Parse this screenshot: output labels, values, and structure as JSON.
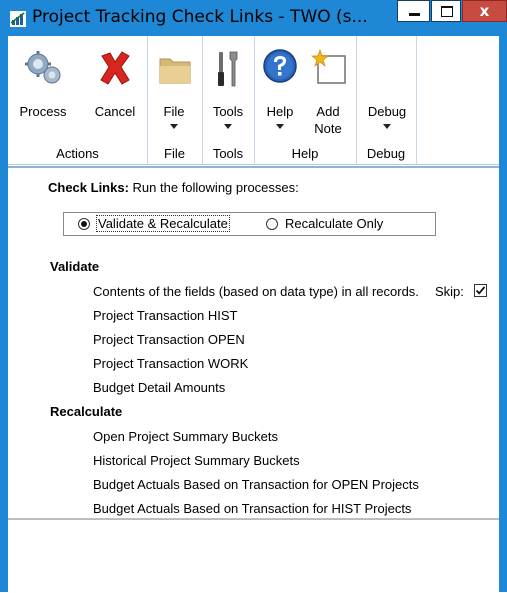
{
  "window": {
    "title": "Project Tracking Check Links  -  TWO (s...",
    "close_glyph": "x"
  },
  "ribbon": {
    "groups": [
      {
        "label": "Actions",
        "buttons": [
          {
            "label": "Process",
            "icon": "gears-icon"
          },
          {
            "label": "Cancel",
            "icon": "red-x-icon"
          }
        ]
      },
      {
        "label": "File",
        "buttons": [
          {
            "label": "File",
            "icon": "folder-icon"
          }
        ]
      },
      {
        "label": "Tools",
        "buttons": [
          {
            "label": "Tools",
            "icon": "tools-icon"
          }
        ]
      },
      {
        "label": "Help",
        "buttons": [
          {
            "label": "Help",
            "icon": "help-icon"
          },
          {
            "label_line1": "Add",
            "label_line2": "Note",
            "icon": "note-icon"
          }
        ]
      },
      {
        "label": "Debug",
        "buttons": [
          {
            "label": "Debug"
          }
        ]
      }
    ]
  },
  "form": {
    "check_links_label": "Check Links:",
    "check_links_desc": "Run the following processes:",
    "options": [
      {
        "label": "Validate & Recalculate",
        "selected": true
      },
      {
        "label": "Recalculate Only",
        "selected": false
      }
    ],
    "validate": {
      "heading": "Validate",
      "items": [
        "Contents of the fields (based on data type) in all records.",
        "Project Transaction HIST",
        "Project Transaction OPEN",
        "Project Transaction WORK",
        "Budget Detail Amounts"
      ],
      "skip_label": "Skip:",
      "skip_checked": true
    },
    "recalculate": {
      "heading": "Recalculate",
      "items": [
        "Open Project Summary Buckets",
        "Historical Project Summary Buckets",
        "Budget Actuals Based on Transaction for OPEN Projects",
        "Budget Actuals Based on Transaction for HIST Projects"
      ]
    }
  },
  "colors": {
    "title_bar": "#1e87d6",
    "close_button": "#c74b40"
  }
}
